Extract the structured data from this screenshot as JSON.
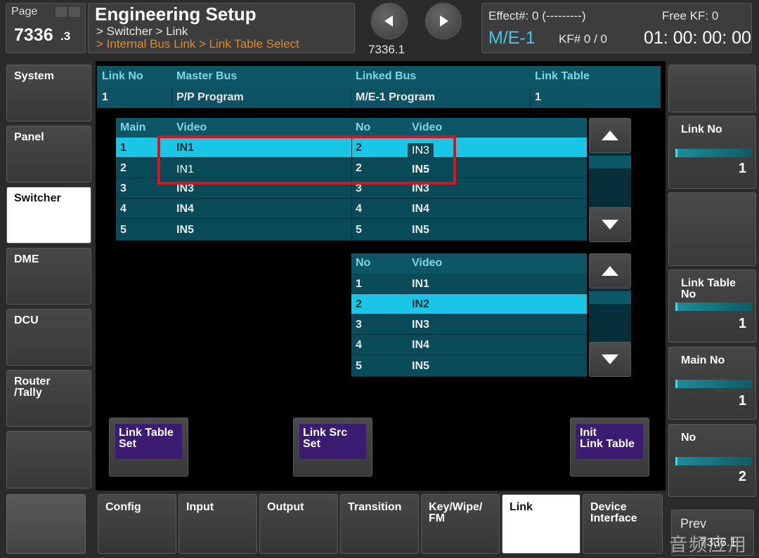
{
  "header": {
    "page_label": "Page",
    "page_number": "7336",
    "page_sub": ".3",
    "title": "Engineering Setup",
    "breadcrumb_1": "> Switcher > Link",
    "breadcrumb_2": "> Internal Bus Link > Link Table Select",
    "nav_page": "7336.1",
    "effect": "Effect#: 0 (---------)",
    "free_kf": "Free KF: 0",
    "me": "M/E-1",
    "kf": "KF# 0 / 0",
    "time": "01: 00: 00: 00",
    "prev_icon": "chevron-left-icon",
    "next_icon": "chevron-right-icon"
  },
  "sidebar": {
    "items": [
      {
        "label": "System",
        "active": false
      },
      {
        "label": "Panel",
        "active": false
      },
      {
        "label": "Switcher",
        "active": true
      },
      {
        "label": "DME",
        "active": false
      },
      {
        "label": "DCU",
        "active": false
      },
      {
        "label": "Router\n/Tally",
        "active": false
      }
    ]
  },
  "link_table": {
    "headers": [
      "Link No",
      "Master Bus",
      "Linked Bus",
      "Link Table"
    ],
    "row": [
      "1",
      "P/P Program",
      "M/E-1 Program",
      "1"
    ]
  },
  "main_table": {
    "headers": [
      "Main",
      "Video",
      "No",
      "Video"
    ],
    "rows": [
      {
        "main": "1",
        "video": "IN1",
        "no": "2",
        "video2": "IN3",
        "selected": true
      },
      {
        "main": "2",
        "video": "IN1",
        "no": "2",
        "video2": "IN5",
        "selected": false
      },
      {
        "main": "3",
        "video": "IN3",
        "no": "3",
        "video2": "IN3",
        "selected": false
      },
      {
        "main": "4",
        "video": "IN4",
        "no": "4",
        "video2": "IN4",
        "selected": false
      },
      {
        "main": "5",
        "video": "IN5",
        "no": "5",
        "video2": "IN5",
        "selected": false
      }
    ]
  },
  "src_table": {
    "headers": [
      "No",
      "Video"
    ],
    "rows": [
      {
        "no": "1",
        "video": "IN1",
        "selected": false
      },
      {
        "no": "2",
        "video": "IN2",
        "selected": true
      },
      {
        "no": "3",
        "video": "IN3",
        "selected": false
      },
      {
        "no": "4",
        "video": "IN4",
        "selected": false
      },
      {
        "no": "5",
        "video": "IN5",
        "selected": false
      }
    ]
  },
  "actions": {
    "link_table_set": "Link Table\nSet",
    "link_src_set": "Link Src\nSet",
    "init_link_table": "Init\nLink Table"
  },
  "params": [
    {
      "label": "Link No",
      "value": "1"
    },
    {
      "label": "Link Table\nNo",
      "value": "1"
    },
    {
      "label": "Main No",
      "value": "1"
    },
    {
      "label": "No",
      "value": "2"
    }
  ],
  "tabs": [
    {
      "label": "Config",
      "active": false
    },
    {
      "label": "Input",
      "active": false
    },
    {
      "label": "Output",
      "active": false
    },
    {
      "label": "Transition",
      "active": false
    },
    {
      "label": "Key/Wipe/\nFM",
      "active": false
    },
    {
      "label": "Link",
      "active": true
    },
    {
      "label": "Device\nInterface",
      "active": false
    }
  ],
  "prev": {
    "label": "Prev",
    "page": "7336.1"
  },
  "watermark": "音频应用",
  "colors": {
    "accent": "#19c6e6",
    "highlight_box": "#d8141e",
    "action_button": "#3c1c73",
    "breadcrumb_orange": "#e08a2a"
  }
}
